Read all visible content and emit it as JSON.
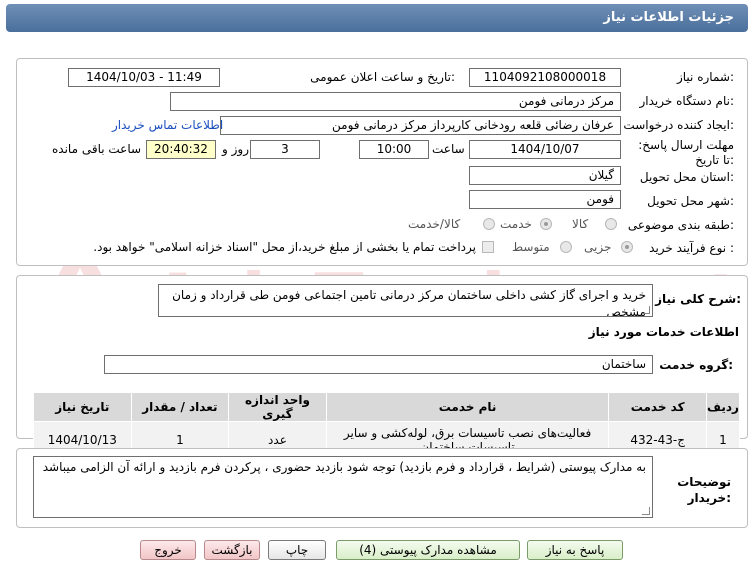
{
  "header": {
    "title": "جزئیات اطلاعات نیاز"
  },
  "fields": {
    "need_number_label": "شماره نیاز:",
    "need_number": "1104092108000018",
    "announce_label": "تاریخ و ساعت اعلان عمومی:",
    "announce_value": "1404/10/03 - 11:49",
    "buyer_org_label": "نام دستگاه خریدار:",
    "buyer_org": "مرکز درمانی فومن",
    "creator_label": "ایجاد کننده درخواست:",
    "creator": "عرفان رضائی قلعه رودخانی کارپرداز مرکز درمانی فومن",
    "contact_link": "اطلاعات تماس خریدار",
    "deadline_label": "مهلت ارسال پاسخ: تا تاریخ:",
    "deadline_date": "1404/10/07",
    "time_label": "ساعت",
    "deadline_time": "10:00",
    "days_value": "3",
    "days_label": "روز و",
    "remaining_value": "20:40:32",
    "remaining_label": "ساعت باقی مانده",
    "province_label": "استان محل تحویل:",
    "province": "گیلان",
    "city_label": "شهر محل تحویل:",
    "city": "فومن",
    "category_label": "طبقه بندی موضوعی:",
    "category_options": [
      "کالا",
      "خدمت",
      "کالا/خدمت"
    ],
    "category_selected": "خدمت",
    "process_label": "نوع فرآیند خرید :",
    "process_options": [
      "جزیی",
      "متوسط"
    ],
    "process_selected": "جزیی",
    "payment_note": "پرداخت تمام یا بخشی از مبلغ خرید،از محل \"اسناد خزانه اسلامی\" خواهد بود."
  },
  "description": {
    "label": "شرح کلی نیاز:",
    "value": "خرید و اجرای گاز کشی داخلی ساختمان مرکز درمانی تامین اجتماعی فومن طی قرارداد و زمان مشخص"
  },
  "services": {
    "section_title": "اطلاعات خدمات مورد نیاز",
    "group_label": "گروه خدمت:",
    "group_value": "ساختمان",
    "columns": [
      "ردیف",
      "کد خدمت",
      "نام خدمت",
      "واحد اندازه گیری",
      "تعداد / مقدار",
      "تاریخ نیاز"
    ],
    "rows": [
      {
        "index": "1",
        "code": "ج-43-432",
        "name": "فعالیت‌های نصب تاسیسات برق، لوله‌کشی و سایر تاسیسات ساختمان",
        "unit": "عدد",
        "qty": "1",
        "date": "1404/10/13"
      }
    ]
  },
  "notes": {
    "label": "توضیحات خریدار:",
    "value": "به مدارک پیوستی (شرایط ، قرارداد و فرم بازدید) توجه شود بازدید حضوری ، پرکردن فرم بازدید و ارائه آن الزامی میباشد"
  },
  "buttons": {
    "reply": "پاسخ به نیاز",
    "attachments": "مشاهده مدارک پیوستی (4)",
    "print": "چاپ",
    "back": "بازگشت",
    "exit": "خروج"
  },
  "watermark": {
    "text": "AriaTender.net"
  },
  "colors": {
    "header": "#5a7eab",
    "yellow": "#ffffc9",
    "link": "#1a4fbf"
  }
}
